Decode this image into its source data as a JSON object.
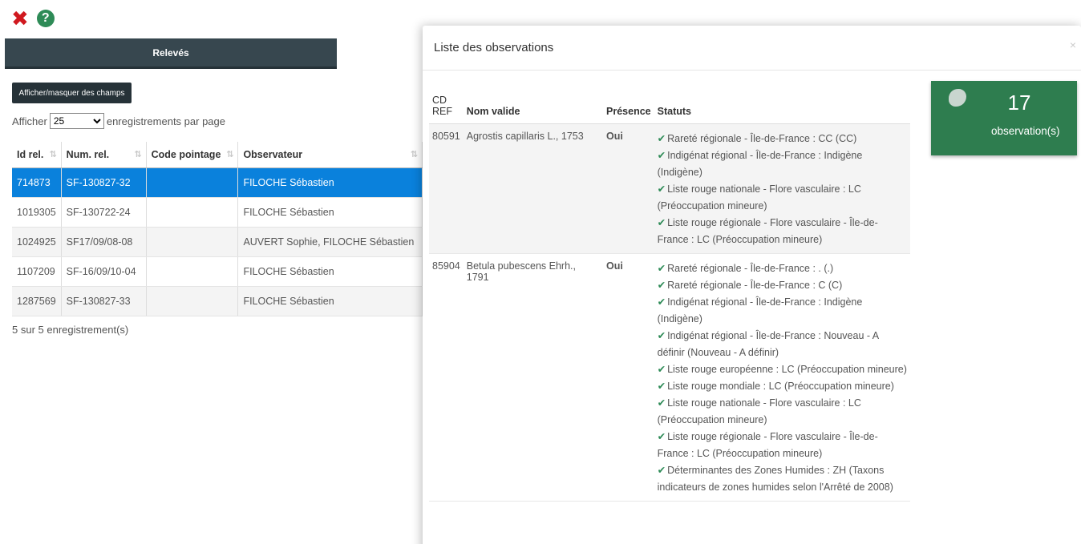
{
  "toolbar": {
    "close_icon": "close-icon",
    "help_icon": "help-icon"
  },
  "tab": {
    "label": "Relevés"
  },
  "toggle_button": "Afficher/masquer des champs",
  "length": {
    "before": "Afficher",
    "value": "25",
    "after": "enregistrements par page"
  },
  "table": {
    "columns": [
      "Id rel.",
      "Num. rel.",
      "Code pointage",
      "Observateur"
    ],
    "rows": [
      {
        "id": "714873",
        "num": "SF-130827-32",
        "code": "",
        "obs": "FILOCHE Sébastien",
        "selected": true
      },
      {
        "id": "1019305",
        "num": "SF-130722-24",
        "code": "",
        "obs": "FILOCHE Sébastien"
      },
      {
        "id": "1024925",
        "num": "SF17/09/08-08",
        "code": "",
        "obs": "AUVERT Sophie, FILOCHE Sébastien"
      },
      {
        "id": "1107209",
        "num": "SF-16/09/10-04",
        "code": "",
        "obs": "FILOCHE Sébastien"
      },
      {
        "id": "1287569",
        "num": "SF-130827-33",
        "code": "",
        "obs": "FILOCHE Sébastien"
      }
    ],
    "info": "5 sur 5 enregistrement(s)"
  },
  "modal": {
    "title": "Liste des observations",
    "close": "×",
    "columns": [
      "CD REF",
      "Nom valide",
      "Présence",
      "Statuts"
    ],
    "rows": [
      {
        "cdref": "80591",
        "nom": "Agrostis capillaris L., 1753",
        "presence": "Oui",
        "statuts": [
          "Rareté régionale - Île-de-France : CC (CC)",
          "Indigénat régional - Île-de-France : Indigène (Indigène)",
          "Liste rouge nationale - Flore vasculaire : LC (Préoccupation mineure)",
          "Liste rouge régionale - Flore vasculaire - Île-de-France : LC (Préoccupation mineure)"
        ]
      },
      {
        "cdref": "85904",
        "nom": "Betula pubescens Ehrh., 1791",
        "presence": "Oui",
        "statuts": [
          "Rareté régionale - Île-de-France : . (.)",
          "Rareté régionale - Île-de-France : C (C)",
          "Indigénat régional - Île-de-France : Indigène (Indigène)",
          "Indigénat régional - Île-de-France : Nouveau - A définir (Nouveau - A définir)",
          "Liste rouge européenne : LC (Préoccupation mineure)",
          "Liste rouge mondiale : LC (Préoccupation mineure)",
          "Liste rouge nationale - Flore vasculaire : LC (Préoccupation mineure)",
          "Liste rouge régionale - Flore vasculaire - Île-de-France : LC (Préoccupation mineure)",
          "Déterminantes des Zones Humides : ZH (Taxons indicateurs de zones humides selon l'Arrêté de 2008)"
        ]
      }
    ],
    "count": {
      "number": "17",
      "label": "observation(s)",
      "icon": "leaf-icon"
    }
  },
  "colors": {
    "accent": "#0a81dc",
    "tab_bg": "#37474f",
    "count_bg": "#2e7d4f",
    "close_red": "#d0191f",
    "help_green": "#2e8b57"
  }
}
